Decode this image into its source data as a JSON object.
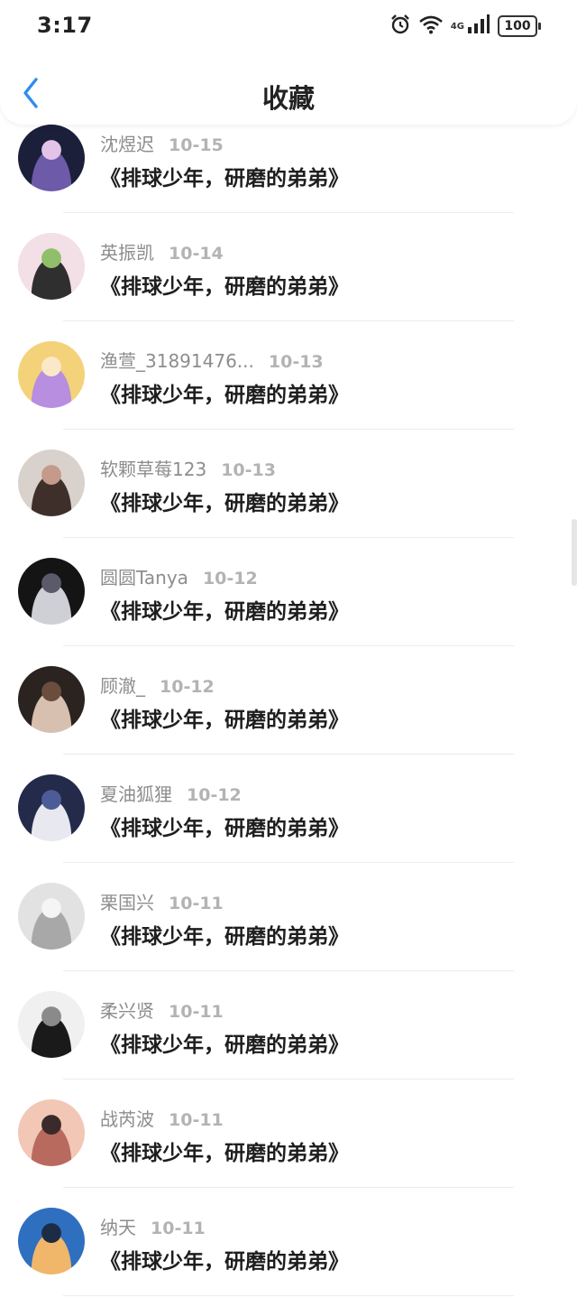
{
  "status_bar": {
    "time": "3:17",
    "network": "4G",
    "battery": "100"
  },
  "header": {
    "title": "收藏"
  },
  "items": [
    {
      "user": "沈煜迟",
      "date": "10-15",
      "text": "《排球少年，研磨的弟弟》",
      "avatar_colors": [
        "#1b1f3a",
        "#6d5aa8",
        "#e3c4e8"
      ]
    },
    {
      "user": "英振凯",
      "date": "10-14",
      "text": "《排球少年，研磨的弟弟》",
      "avatar_colors": [
        "#f3dfe6",
        "#2f2f2f",
        "#8fbf6a"
      ]
    },
    {
      "user": "渔萱_31891476...",
      "date": "10-13",
      "text": "《排球少年，研磨的弟弟》",
      "avatar_colors": [
        "#f4d27a",
        "#b78ee0",
        "#fbe8c9"
      ]
    },
    {
      "user": "软颗草莓123",
      "date": "10-13",
      "text": "《排球少年，研磨的弟弟》",
      "avatar_colors": [
        "#d9d2cc",
        "#3e2f2a",
        "#c49a8a"
      ]
    },
    {
      "user": "圆圆Tanya",
      "date": "10-12",
      "text": "《排球少年，研磨的弟弟》",
      "avatar_colors": [
        "#141414",
        "#cfcfd6",
        "#5a5a6a"
      ]
    },
    {
      "user": "顾澈_",
      "date": "10-12",
      "text": "《排球少年，研磨的弟弟》",
      "avatar_colors": [
        "#2a2320",
        "#d8c0b0",
        "#6b4d3d"
      ]
    },
    {
      "user": "夏油狐狸",
      "date": "10-12",
      "text": "《排球少年，研磨的弟弟》",
      "avatar_colors": [
        "#232a4a",
        "#e8e8f0",
        "#4c5c98"
      ]
    },
    {
      "user": "栗国兴",
      "date": "10-11",
      "text": "《排球少年，研磨的弟弟》",
      "avatar_colors": [
        "#e2e2e2",
        "#a8a8a8",
        "#f5f5f5"
      ]
    },
    {
      "user": "柔兴贤",
      "date": "10-11",
      "text": "《排球少年，研磨的弟弟》",
      "avatar_colors": [
        "#f0f0f0",
        "#1a1a1a",
        "#8a8a8a"
      ]
    },
    {
      "user": "战芮波",
      "date": "10-11",
      "text": "《排球少年，研磨的弟弟》",
      "avatar_colors": [
        "#f2c7b5",
        "#b96a5e",
        "#3a2a2a"
      ]
    },
    {
      "user": "纳天",
      "date": "10-11",
      "text": "《排球少年，研磨的弟弟》",
      "avatar_colors": [
        "#2f6fc0",
        "#f0b66a",
        "#1d2c45"
      ]
    }
  ],
  "colors": {
    "accent": "#2d8cf0",
    "title_text": "#222222",
    "username_text": "#8d8d8d",
    "date_text": "#b3b3b3"
  }
}
